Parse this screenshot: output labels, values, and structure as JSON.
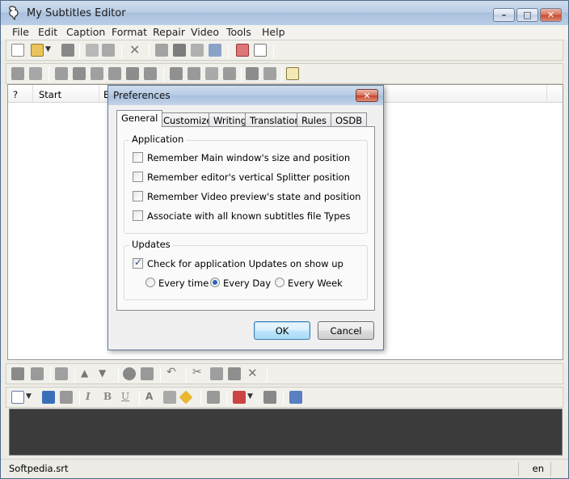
{
  "app": {
    "title": "My Subtitles Editor",
    "window_buttons": {
      "minimize": "–",
      "maximize": "□",
      "close": "✕"
    }
  },
  "menu": [
    "File",
    "Edit",
    "Caption",
    "Format",
    "Repair",
    "Video",
    "Tools",
    "Help"
  ],
  "list": {
    "columns": [
      "?",
      "Start",
      "E"
    ]
  },
  "status": {
    "file": "Softpedia.srt",
    "language": "en"
  },
  "dialog": {
    "title": "Preferences",
    "close_glyph": "✕",
    "tabs": [
      "General",
      "Customize",
      "Writing",
      "Translation",
      "Rules",
      "OSDB"
    ],
    "active_tab": "General",
    "application_group": {
      "label": "Application",
      "options": [
        {
          "label": "Remember Main window's size and position",
          "checked": false
        },
        {
          "label": "Remember editor's vertical Splitter position",
          "checked": false
        },
        {
          "label": "Remember Video preview's state and position",
          "checked": false
        },
        {
          "label": "Associate with all known subtitles file Types",
          "checked": false
        }
      ]
    },
    "updates_group": {
      "label": "Updates",
      "check_label": "Check for application Updates on show up",
      "check_checked": true,
      "frequency": [
        {
          "label": "Every time",
          "selected": false
        },
        {
          "label": "Every Day",
          "selected": true
        },
        {
          "label": "Every Week",
          "selected": false
        }
      ]
    },
    "ok_label": "OK",
    "cancel_label": "Cancel"
  },
  "colors": {
    "editor_bg": "#3b3b3b",
    "title_gradient_top": "#cfdced",
    "accent_blue": "#2b63b8"
  }
}
